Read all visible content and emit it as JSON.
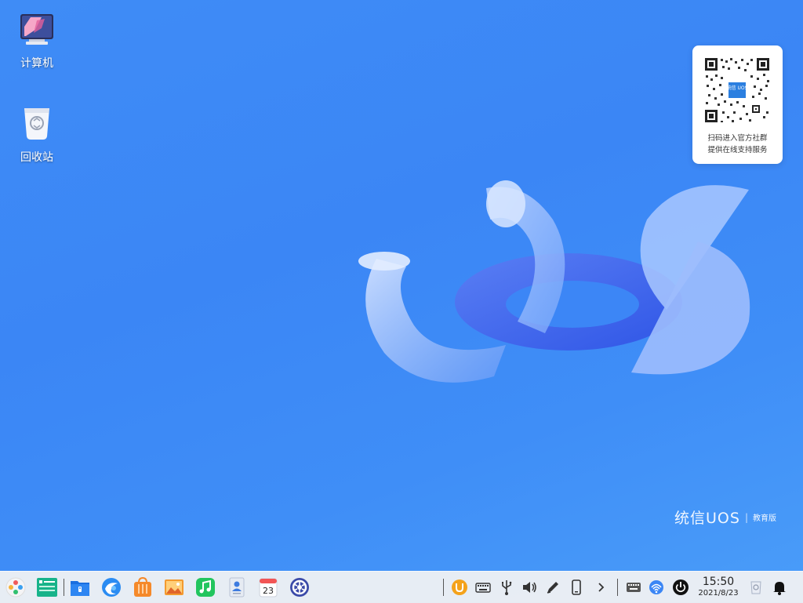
{
  "desktop": {
    "icons": [
      {
        "label": "计算机",
        "icon": "computer-icon"
      },
      {
        "label": "回收站",
        "icon": "trash-icon"
      }
    ]
  },
  "qr_card": {
    "line1": "扫码进入官方社群",
    "line2": "提供在线支持服务",
    "center_logo": "统信 UOS"
  },
  "branding": {
    "name": "统信UOS",
    "separator": "|",
    "edition": "教育版"
  },
  "taskbar": {
    "apps": [
      {
        "name": "launcher",
        "icon": "launcher-icon"
      },
      {
        "name": "multitasking-view",
        "icon": "multitasking-icon"
      },
      {
        "name": "file-manager",
        "icon": "file-manager-icon"
      },
      {
        "name": "browser",
        "icon": "browser-icon"
      },
      {
        "name": "app-store",
        "icon": "app-store-icon"
      },
      {
        "name": "image-viewer",
        "icon": "image-viewer-icon"
      },
      {
        "name": "music",
        "icon": "music-icon"
      },
      {
        "name": "contacts",
        "icon": "contacts-icon"
      },
      {
        "name": "calendar",
        "icon": "calendar-icon",
        "day": "23"
      },
      {
        "name": "settings",
        "icon": "settings-icon"
      }
    ],
    "tray": [
      "input-method-icon",
      "keyboard-icon",
      "usb-icon",
      "volume-icon",
      "pen-icon",
      "phone-icon",
      "expand-arrow-icon",
      "onscreen-keyboard-icon",
      "network-icon",
      "power-icon"
    ],
    "clock": {
      "time": "15:50",
      "date": "2021/8/23"
    },
    "colors": {
      "accent": "#3b86f5",
      "taskbar_bg": "#eef0f4"
    }
  }
}
